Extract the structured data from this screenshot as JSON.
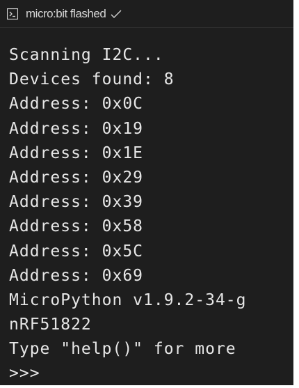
{
  "status": {
    "label": "micro:bit flashed",
    "terminal_icon": "terminal-icon",
    "check_icon": "checkmark-icon"
  },
  "console": {
    "lines": [
      "Scanning I2C...",
      "Devices found: 8",
      "Address: 0x0C",
      "Address: 0x19",
      "Address: 0x1E",
      "Address: 0x29",
      "Address: 0x39",
      "Address: 0x58",
      "Address: 0x5C",
      "Address: 0x69",
      "MicroPython v1.9.2-34-g",
      "nRF51822",
      "Type \"help()\" for more"
    ],
    "prompt": ">>>"
  },
  "colors": {
    "background": "#1e1e1e",
    "text": "#e6e6e6",
    "status_text": "#d4d4d4"
  }
}
